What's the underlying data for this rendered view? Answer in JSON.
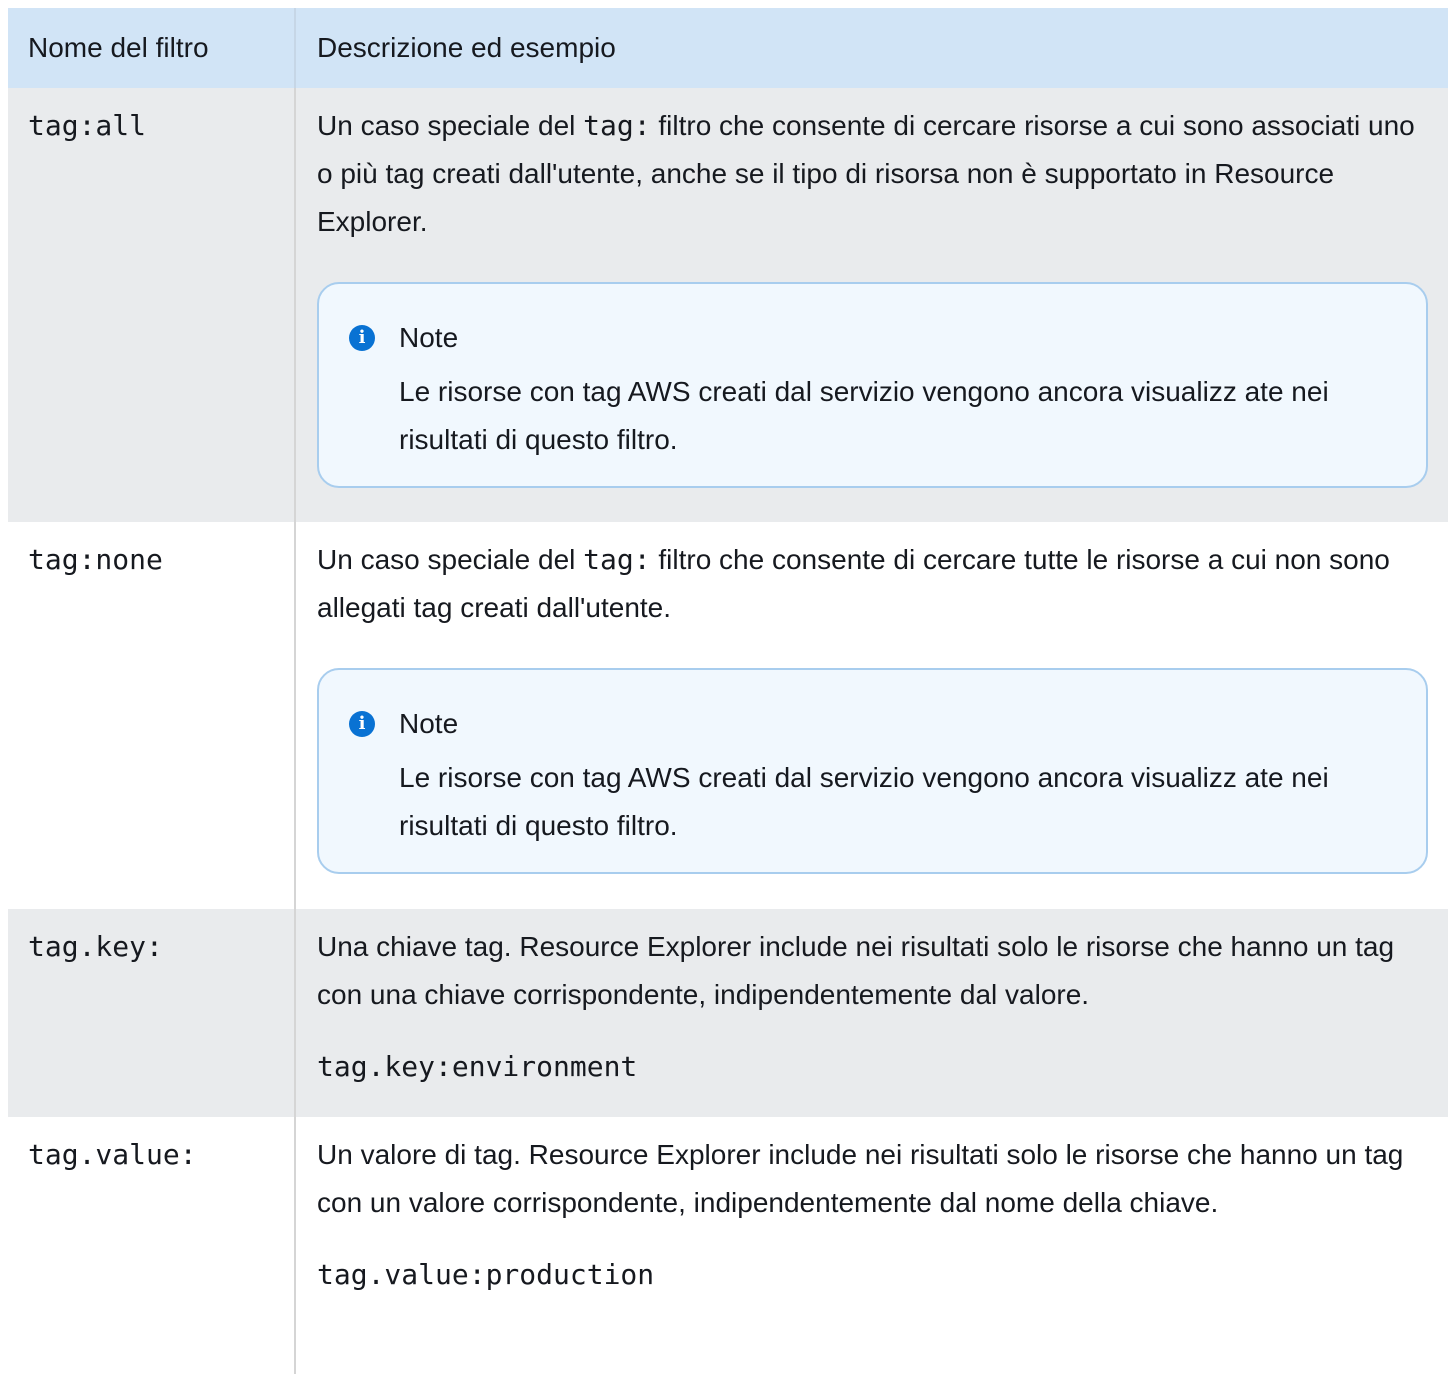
{
  "table": {
    "headers": [
      "Nome del filtro",
      "Descrizione ed esempio"
    ],
    "rows": [
      {
        "name": "tag:all",
        "desc_pre": "Un caso speciale del ",
        "desc_code": "tag:",
        "desc_post": " filtro che consente di cercare risorse a cui sono associati uno o più tag creati dall'utente, anche se il tipo di risorsa non è supportato in Resource Explorer.",
        "note_title": "Note",
        "note_text": "Le risorse con tag AWS creati dal servizio vengono ancora visualizz ate nei risultati di questo filtro."
      },
      {
        "name": "tag:none",
        "desc_pre": "Un caso speciale del ",
        "desc_code": "tag:",
        "desc_post": " filtro che consente di cercare tutte le risorse a cui non sono allegati tag creati dall'utente.",
        "note_title": "Note",
        "note_text": "Le risorse con tag AWS creati dal servizio vengono ancora visualizz ate nei risultati di questo filtro."
      },
      {
        "name": "tag.key:",
        "desc": "Una chiave tag. Resource Explorer include nei risultati solo le risorse che hanno un tag con una chiave corrispondente, indipendentemente dal valore.",
        "example": "tag.key:environment"
      },
      {
        "name": "tag.value:",
        "desc": "Un valore di tag. Resource Explorer include nei risultati solo le risorse che hanno un tag con un valore corrispondente, indipendentemente dal nome della chiave.",
        "example": "tag.value:production"
      }
    ]
  },
  "icons": {
    "note_icon": "info-icon",
    "note_icon_glyph": "i"
  },
  "colors": {
    "header_bg": "#d1e4f6",
    "row_alt_bg": "#e9ebed",
    "note_bg": "#f1f8fe",
    "note_border": "#a8cdee",
    "info_icon": "#0972d3"
  }
}
